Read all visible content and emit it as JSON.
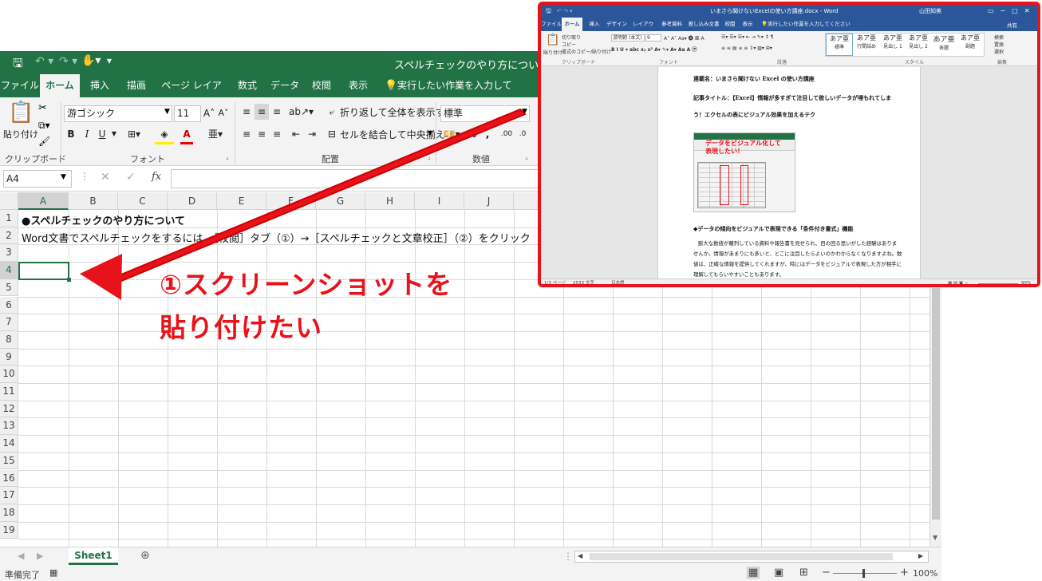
{
  "excel": {
    "title": "スペルチェックのやり方について.xlsx  -  Exc",
    "tabs": [
      "ファイル",
      "ホーム",
      "挿入",
      "描画",
      "ページ レイアウト",
      "数式",
      "データ",
      "校閲",
      "表示"
    ],
    "tell_me": "実行したい作業を入力してください",
    "ribbon": {
      "paste": "貼り付け",
      "font_name": "游ゴシック",
      "font_size": "11",
      "wrap": "折り返して全体を表示する",
      "merge": "セルを結合して中央揃え",
      "number_format": "標準",
      "groups": [
        "クリップボード",
        "フォント",
        "配置",
        "数値"
      ]
    },
    "name_box": "A4",
    "fx": "fx",
    "columns": [
      "A",
      "B",
      "C",
      "D",
      "E",
      "F",
      "G",
      "H",
      "I",
      "J"
    ],
    "rows": [
      "1",
      "2",
      "3",
      "4",
      "5",
      "6",
      "7",
      "8",
      "9",
      "10",
      "11",
      "12",
      "13",
      "14",
      "15",
      "16",
      "17",
      "18",
      "19"
    ],
    "cells": {
      "a1": "●スペルチェックのやり方について",
      "a2": "Word文書でスペルチェックをするには、［校閲］タブ（①）→［スペルチェックと文章校正］（②）をクリック"
    },
    "sheet_tab": "Sheet1",
    "status": {
      "ready": "準備完了",
      "zoom": "100%"
    }
  },
  "word": {
    "title": "いまさら聞けないExcelの使い方講座.docx  -  Word",
    "user": "山田知美",
    "tabs": [
      "ファイル",
      "ホーム",
      "挿入",
      "デザイン",
      "レイアウト",
      "参考資料",
      "差し込み文書",
      "校閲",
      "表示"
    ],
    "tell_me": "実行したい作業を入力してください",
    "share": "共有",
    "ribbon": {
      "paste": "貼り付け",
      "cut": "切り取り",
      "copy": "コピー",
      "format_painter": "書式のコピー/貼り付け",
      "font_name": "游明朝 (本文)",
      "font_size": "9",
      "styles": [
        {
          "sample": "あア亜",
          "name": "標準"
        },
        {
          "sample": "あア亜",
          "name": "行間詰め"
        },
        {
          "sample": "あア亜",
          "name": "見出し 1"
        },
        {
          "sample": "あア亜",
          "name": "見出し 2"
        },
        {
          "sample": "あア亜",
          "name": "表題"
        },
        {
          "sample": "あア亜",
          "name": "副題"
        }
      ],
      "groups": [
        "クリップボード",
        "フォント",
        "段落",
        "スタイル",
        "編集"
      ],
      "search": "検索",
      "replace": "置換",
      "select": "選択"
    },
    "doc": {
      "line1": "連載名：いまさら聞けない Excel の使い方講座",
      "line2": "記事タイトル：【Excel】情報が多すぎて注目して欲しいデータが埋もれてしま",
      "line3": "う！エクセルの表にビジュアル効果を加えるテク",
      "image_caption": "データをビジュアル化して表現したい！",
      "heading": "◆データの傾向をビジュアルで表現できる「条件付き書式」機能",
      "p1": "膨大な数値が羅列している資料や報告書を見せられ、目の回る思いがした経験はありま",
      "p2": "せんか。情報があまりにも多いと、どこに注目したらよいのかわからなくなりますよね。数",
      "p3": "値は、正確な情報を提供してくれますが、時にはデータをビジュアルで表現した方が相手に",
      "p4": "理解してもらいやすいこともあります。"
    },
    "status": {
      "page": "1/3 ページ",
      "words": "2533 文字",
      "lang": "日本語",
      "zoom": "90%"
    }
  },
  "annotation": {
    "line1": "①スクリーンショットを",
    "line2": "貼り付けたい"
  },
  "colors": {
    "excel_green": "#217346",
    "word_blue": "#2b579a",
    "highlight_red": "#e8121a"
  }
}
